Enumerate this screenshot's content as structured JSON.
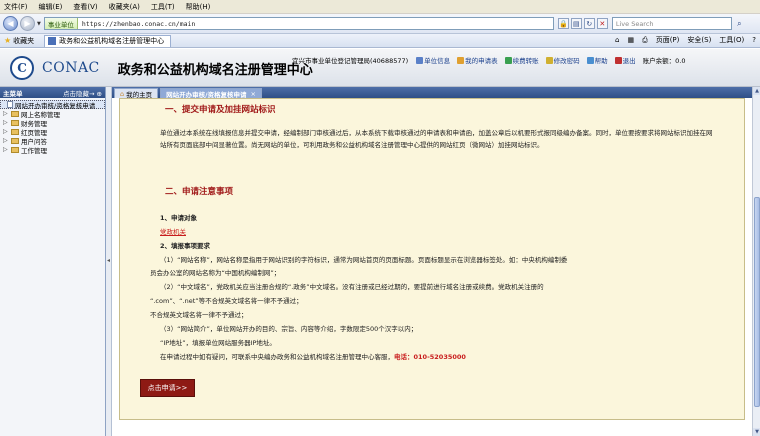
{
  "menubar": {
    "items": [
      "文件(F)",
      "编辑(E)",
      "查看(V)",
      "收藏夹(A)",
      "工具(T)",
      "帮助(H)"
    ]
  },
  "address": {
    "site_badge": "事业单位",
    "url": "https://zhenbao.conac.cn/main",
    "search_placeholder": "Live Search"
  },
  "favorites_bar": {
    "favorites_label": "收藏夹",
    "tab_title": "政务和公益机构域名注册管理中心",
    "tools": [
      "页面(P)",
      "安全(S)",
      "工具(O)"
    ]
  },
  "header": {
    "logo_letter": "C",
    "logo_text": "CONAC",
    "app_title": "政务和公益机构域名注册管理中心",
    "org_name": "宜兴市事业单位登记管理局(40688577)",
    "links": [
      "单位信息",
      "我的申请表",
      "续费转账",
      "修改密码",
      "帮助",
      "退出"
    ],
    "balance": "账户余额：0.0"
  },
  "sidebar": {
    "title": "主菜单",
    "hide_label": "点击隐藏→",
    "tree": [
      {
        "label": "网站开办审核/资格复核申请",
        "selected": true,
        "type": "doc"
      },
      {
        "label": "网上名称管理",
        "selected": false,
        "type": "folder"
      },
      {
        "label": "财务管理",
        "selected": false,
        "type": "folder"
      },
      {
        "label": "红页管理",
        "selected": false,
        "type": "folder"
      },
      {
        "label": "用户问答",
        "selected": false,
        "type": "folder"
      },
      {
        "label": "工作管理",
        "selected": false,
        "type": "folder"
      }
    ]
  },
  "content_tabs": [
    {
      "label": "我的主页",
      "active": false
    },
    {
      "label": "网站开办审核/资格复核申请",
      "active": true
    }
  ],
  "content": {
    "section1_title": "一、提交申请及加挂网站标识",
    "section1_para": "单位通过本系统在线填报信息并提交申请，经编制部门审核通过后，从本系统下载审核通过的申请表和申请函，加盖公章后以机要形式报同级编办备案。同时，单位要按要求将网站标识加挂在网站所有页面底部中间显著位置。尚无网站的单位，可利用政务和公益机构域名注册管理中心提供的网站红页（微网站）加挂网站标识。",
    "section2_title": "二、申请注意事项",
    "item1_title": "1、申请对象",
    "item1_link": "党政机关",
    "item2_title": "2、填报事项要求",
    "req1": "（1）“网站名称”，网站名称是指用于网站识别的字符标识，通常为网站首页的页面标题。页面标题显示在浏览器标签处。如：中央机构编制委",
    "req1b": "员会办公室的网站名称为“中国机构编制网”；",
    "req2": "（2）“中文域名”，党政机关应当注册合规的“.政务”中文域名。没有注册或已经过期的，要提前进行域名注册或续费。党政机关注册的",
    "req2b": "“.com”、“.net”等不合规英文域名将一律不予通过；",
    "req2c": "不合规英文域名将一律不予通过；",
    "req3": "（3）“网站简介”，单位网站开办的目的、宗旨、内容等介绍，字数限定500个汉字以内；",
    "req4": "“IP地址”，填报单位网站服务器IP地址。",
    "contact": "在申请过程中如有疑问，可联系中央编办政务和公益机构域名注册管理中心客服，",
    "phone": "电话：010-52035000",
    "apply_button": "点击申请>>"
  },
  "colors": {
    "accent_blue": "#2f4f86",
    "title_red": "#a01818",
    "panel_bg": "#fbf6dc",
    "button_red": "#8e1a14"
  }
}
